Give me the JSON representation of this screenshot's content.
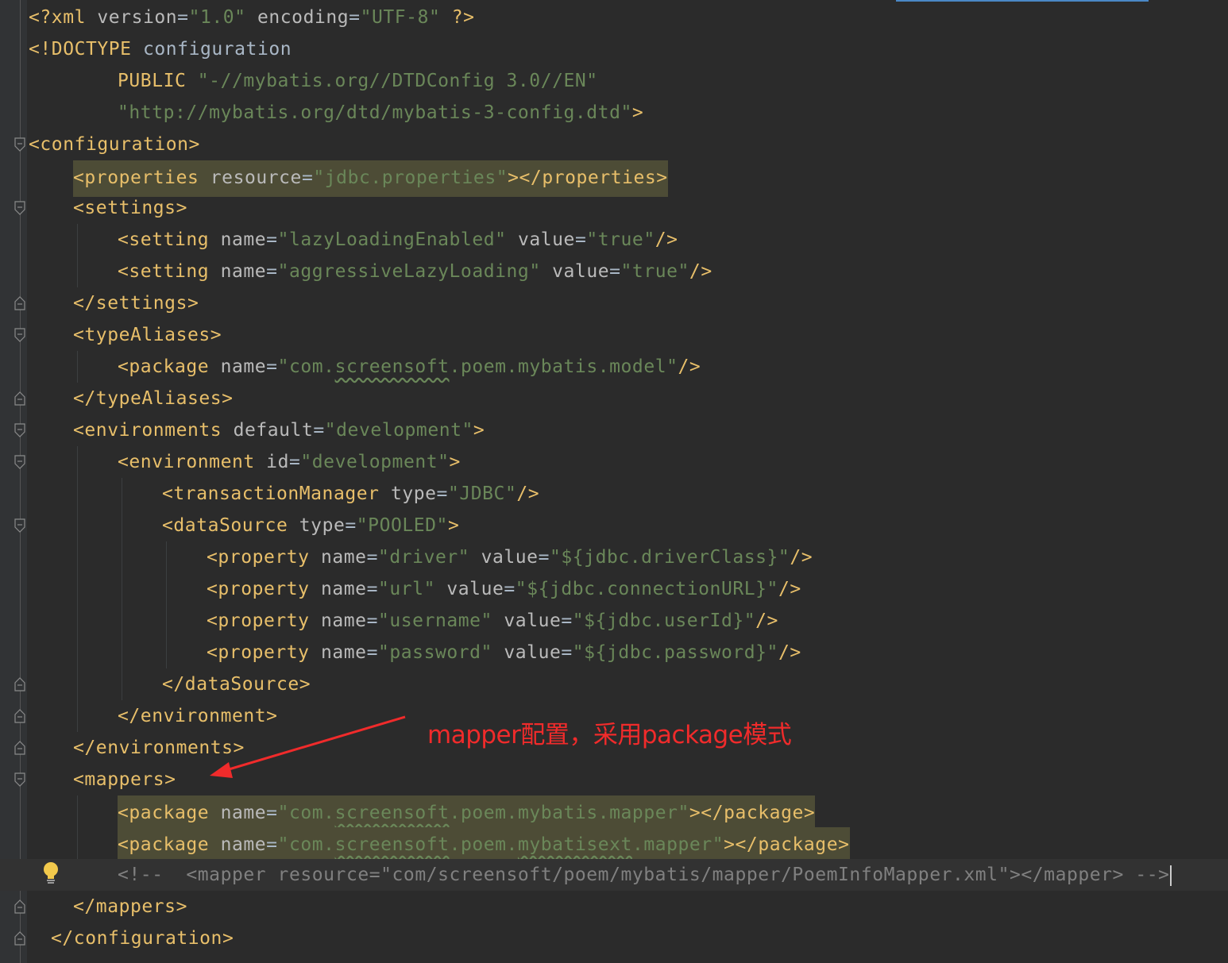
{
  "editor": {
    "file_type": "xml",
    "lines": [
      {
        "tokens": [
          {
            "c": "tag",
            "t": "<?xml "
          },
          {
            "c": "attr",
            "t": "version"
          },
          {
            "c": "txt",
            "t": "="
          },
          {
            "c": "str",
            "t": "\"1.0\""
          },
          {
            "c": "txt",
            "t": " "
          },
          {
            "c": "attr",
            "t": "encoding"
          },
          {
            "c": "txt",
            "t": "="
          },
          {
            "c": "str",
            "t": "\"UTF-8\""
          },
          {
            "c": "txt",
            "t": " "
          },
          {
            "c": "tag",
            "t": "?>"
          }
        ]
      },
      {
        "tokens": [
          {
            "c": "tag",
            "t": "<!DOCTYPE "
          },
          {
            "c": "txt",
            "t": "configuration"
          }
        ]
      },
      {
        "tokens": [
          {
            "c": "tag",
            "t": "PUBLIC "
          },
          {
            "c": "str",
            "t": "\"-//mybatis.org//DTDConfig 3.0//EN\""
          }
        ]
      },
      {
        "tokens": [
          {
            "c": "str",
            "t": "\"http://mybatis.org/dtd/mybatis-3-config.dtd\""
          },
          {
            "c": "tag",
            "t": ">"
          }
        ]
      },
      {
        "tokens": [
          {
            "c": "tag",
            "t": "<configuration>"
          }
        ]
      },
      {
        "highlight": true,
        "tokens": [
          {
            "c": "tag",
            "t": "<properties "
          },
          {
            "c": "attr",
            "t": "resource"
          },
          {
            "c": "txt",
            "t": "="
          },
          {
            "c": "str",
            "t": "\"jdbc.properties\""
          },
          {
            "c": "tag",
            "t": "></properties>"
          }
        ]
      },
      {
        "tokens": [
          {
            "c": "tag",
            "t": "<settings>"
          }
        ]
      },
      {
        "tokens": [
          {
            "c": "tag",
            "t": "<setting "
          },
          {
            "c": "attr",
            "t": "name"
          },
          {
            "c": "txt",
            "t": "="
          },
          {
            "c": "str",
            "t": "\"lazyLoadingEnabled\""
          },
          {
            "c": "txt",
            "t": " "
          },
          {
            "c": "attr",
            "t": "value"
          },
          {
            "c": "txt",
            "t": "="
          },
          {
            "c": "str",
            "t": "\"true\""
          },
          {
            "c": "tag",
            "t": "/>"
          }
        ]
      },
      {
        "tokens": [
          {
            "c": "tag",
            "t": "<setting "
          },
          {
            "c": "attr",
            "t": "name"
          },
          {
            "c": "txt",
            "t": "="
          },
          {
            "c": "str",
            "t": "\"aggressiveLazyLoading\""
          },
          {
            "c": "txt",
            "t": " "
          },
          {
            "c": "attr",
            "t": "value"
          },
          {
            "c": "txt",
            "t": "="
          },
          {
            "c": "str",
            "t": "\"true\""
          },
          {
            "c": "tag",
            "t": "/>"
          }
        ]
      },
      {
        "tokens": [
          {
            "c": "tag",
            "t": "</settings>"
          }
        ]
      },
      {
        "tokens": [
          {
            "c": "tag",
            "t": "<typeAliases>"
          }
        ]
      },
      {
        "tokens": [
          {
            "c": "tag",
            "t": "<package "
          },
          {
            "c": "attr",
            "t": "name"
          },
          {
            "c": "txt",
            "t": "="
          },
          {
            "c": "str",
            "t": "\"com."
          },
          {
            "c": "str sq",
            "t": "screensoft"
          },
          {
            "c": "str",
            "t": ".poem.mybatis.model\""
          },
          {
            "c": "tag",
            "t": "/>"
          }
        ]
      },
      {
        "tokens": [
          {
            "c": "tag",
            "t": "</typeAliases>"
          }
        ]
      },
      {
        "tokens": [
          {
            "c": "tag",
            "t": "<environments "
          },
          {
            "c": "attr",
            "t": "default"
          },
          {
            "c": "txt",
            "t": "="
          },
          {
            "c": "str",
            "t": "\"development\""
          },
          {
            "c": "tag",
            "t": ">"
          }
        ]
      },
      {
        "tokens": [
          {
            "c": "tag",
            "t": "<environment "
          },
          {
            "c": "attr",
            "t": "id"
          },
          {
            "c": "txt",
            "t": "="
          },
          {
            "c": "str",
            "t": "\"development\""
          },
          {
            "c": "tag",
            "t": ">"
          }
        ]
      },
      {
        "tokens": [
          {
            "c": "tag",
            "t": "<transactionManager "
          },
          {
            "c": "attr",
            "t": "type"
          },
          {
            "c": "txt",
            "t": "="
          },
          {
            "c": "str",
            "t": "\"JDBC\""
          },
          {
            "c": "tag",
            "t": "/>"
          }
        ]
      },
      {
        "tokens": [
          {
            "c": "tag",
            "t": "<dataSource "
          },
          {
            "c": "attr",
            "t": "type"
          },
          {
            "c": "txt",
            "t": "="
          },
          {
            "c": "str",
            "t": "\"POOLED\""
          },
          {
            "c": "tag",
            "t": ">"
          }
        ]
      },
      {
        "tokens": [
          {
            "c": "tag",
            "t": "<property "
          },
          {
            "c": "attr",
            "t": "name"
          },
          {
            "c": "txt",
            "t": "="
          },
          {
            "c": "str",
            "t": "\"driver\""
          },
          {
            "c": "txt",
            "t": " "
          },
          {
            "c": "attr",
            "t": "value"
          },
          {
            "c": "txt",
            "t": "="
          },
          {
            "c": "str",
            "t": "\"${jdbc.driverClass}\""
          },
          {
            "c": "tag",
            "t": "/>"
          }
        ]
      },
      {
        "tokens": [
          {
            "c": "tag",
            "t": "<property "
          },
          {
            "c": "attr",
            "t": "name"
          },
          {
            "c": "txt",
            "t": "="
          },
          {
            "c": "str",
            "t": "\"url\""
          },
          {
            "c": "txt",
            "t": " "
          },
          {
            "c": "attr",
            "t": "value"
          },
          {
            "c": "txt",
            "t": "="
          },
          {
            "c": "str",
            "t": "\"${jdbc.connectionURL}\""
          },
          {
            "c": "tag",
            "t": "/>"
          }
        ]
      },
      {
        "tokens": [
          {
            "c": "tag",
            "t": "<property "
          },
          {
            "c": "attr",
            "t": "name"
          },
          {
            "c": "txt",
            "t": "="
          },
          {
            "c": "str",
            "t": "\"username\""
          },
          {
            "c": "txt",
            "t": " "
          },
          {
            "c": "attr",
            "t": "value"
          },
          {
            "c": "txt",
            "t": "="
          },
          {
            "c": "str",
            "t": "\"${jdbc.userId}\""
          },
          {
            "c": "tag",
            "t": "/>"
          }
        ]
      },
      {
        "tokens": [
          {
            "c": "tag",
            "t": "<property "
          },
          {
            "c": "attr",
            "t": "name"
          },
          {
            "c": "txt",
            "t": "="
          },
          {
            "c": "str",
            "t": "\"password\""
          },
          {
            "c": "txt",
            "t": " "
          },
          {
            "c": "attr",
            "t": "value"
          },
          {
            "c": "txt",
            "t": "="
          },
          {
            "c": "str",
            "t": "\"${jdbc.password}\""
          },
          {
            "c": "tag",
            "t": "/>"
          }
        ]
      },
      {
        "tokens": [
          {
            "c": "tag",
            "t": "</dataSource>"
          }
        ]
      },
      {
        "tokens": [
          {
            "c": "tag",
            "t": "</environment>"
          }
        ]
      },
      {
        "tokens": [
          {
            "c": "tag",
            "t": "</environments>"
          }
        ]
      },
      {
        "tokens": [
          {
            "c": "tag",
            "t": "<mappers>"
          }
        ]
      },
      {
        "highlight": true,
        "tokens": [
          {
            "c": "tag",
            "t": "<package "
          },
          {
            "c": "attr",
            "t": "name"
          },
          {
            "c": "txt",
            "t": "="
          },
          {
            "c": "str",
            "t": "\"com."
          },
          {
            "c": "str sq",
            "t": "screensoft"
          },
          {
            "c": "str",
            "t": ".poem.mybatis.mapper\""
          },
          {
            "c": "tag",
            "t": "></package>"
          }
        ]
      },
      {
        "highlight": true,
        "tokens": [
          {
            "c": "tag",
            "t": "<package "
          },
          {
            "c": "attr",
            "t": "name"
          },
          {
            "c": "txt",
            "t": "="
          },
          {
            "c": "str",
            "t": "\"com."
          },
          {
            "c": "str sq",
            "t": "screensoft"
          },
          {
            "c": "str",
            "t": ".poem."
          },
          {
            "c": "str sq",
            "t": "mybatisext"
          },
          {
            "c": "str",
            "t": ".mapper\""
          },
          {
            "c": "tag",
            "t": "></package>"
          }
        ]
      },
      {
        "current": true,
        "caret": true,
        "tokens": [
          {
            "c": "cmt",
            "t": "<!--  <mapper resource=\"com/screensoft/poem/mybatis/mapper/PoemInfoMapper.xml\"></mapper> -->"
          }
        ]
      },
      {
        "tokens": [
          {
            "c": "tag",
            "t": "</mappers>"
          }
        ]
      },
      {
        "tokens": [
          {
            "c": "tag",
            "t": "</configuration>"
          }
        ]
      }
    ]
  },
  "annotation": {
    "text": "mapper配置，采用package模式",
    "color": "#f02b2b"
  },
  "colors": {
    "background": "#2b2b2b",
    "gutter": "#313335",
    "tag": "#e8bf6a",
    "attribute": "#bababa",
    "string": "#6a8759",
    "comment": "#808080",
    "match_highlight": "#4d4c36"
  },
  "icons": {
    "fold_open": "fold-open-icon",
    "fold_close": "fold-close-icon",
    "intention": "lightbulb-icon"
  }
}
